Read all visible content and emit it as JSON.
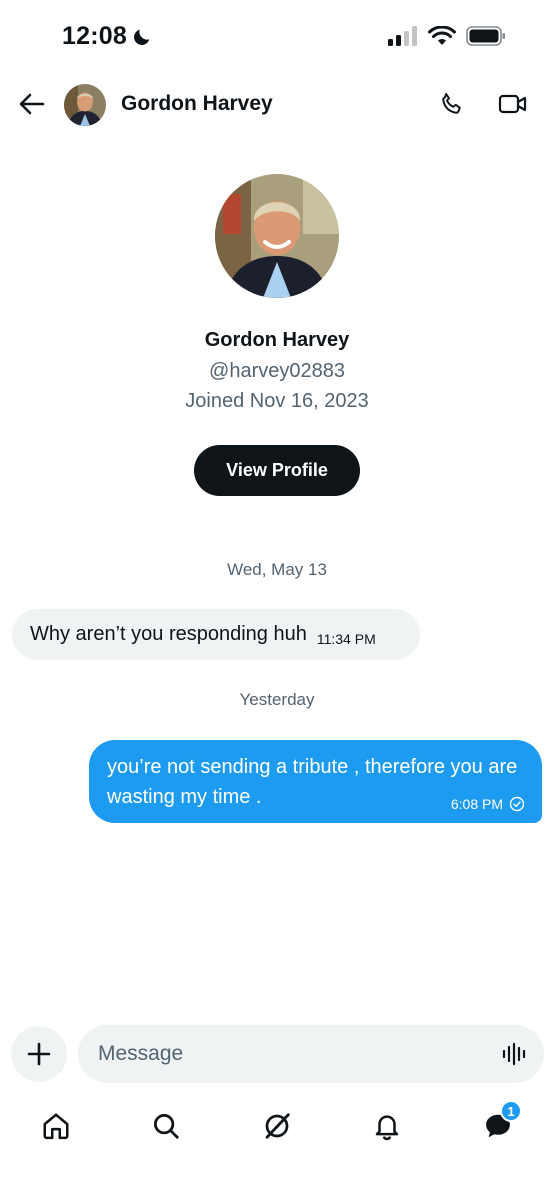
{
  "status_bar": {
    "time": "12:08"
  },
  "header": {
    "contact_name": "Gordon Harvey"
  },
  "profile": {
    "name": "Gordon Harvey",
    "handle": "@harvey02883",
    "joined": "Joined Nov 16, 2023",
    "view_profile_label": "View Profile"
  },
  "conversation": {
    "dividers": [
      "Wed, May 13",
      "Yesterday"
    ],
    "messages": [
      {
        "direction": "incoming",
        "text": "Why aren’t you responding huh",
        "time": "11:34 PM"
      },
      {
        "direction": "outgoing",
        "text": "you’re not sending a tribute , therefore you are wasting my time .",
        "time": "6:08 PM"
      }
    ]
  },
  "composer": {
    "placeholder": "Message"
  },
  "bottom_nav": {
    "items": [
      "home-icon",
      "search-icon",
      "grok-icon",
      "notifications-icon",
      "messages-icon"
    ],
    "messages_badge": "1"
  },
  "colors": {
    "accent": "#1d9bf0",
    "text": "#0f1419",
    "secondary": "#536471",
    "bubble_incoming": "#eff3f4"
  }
}
